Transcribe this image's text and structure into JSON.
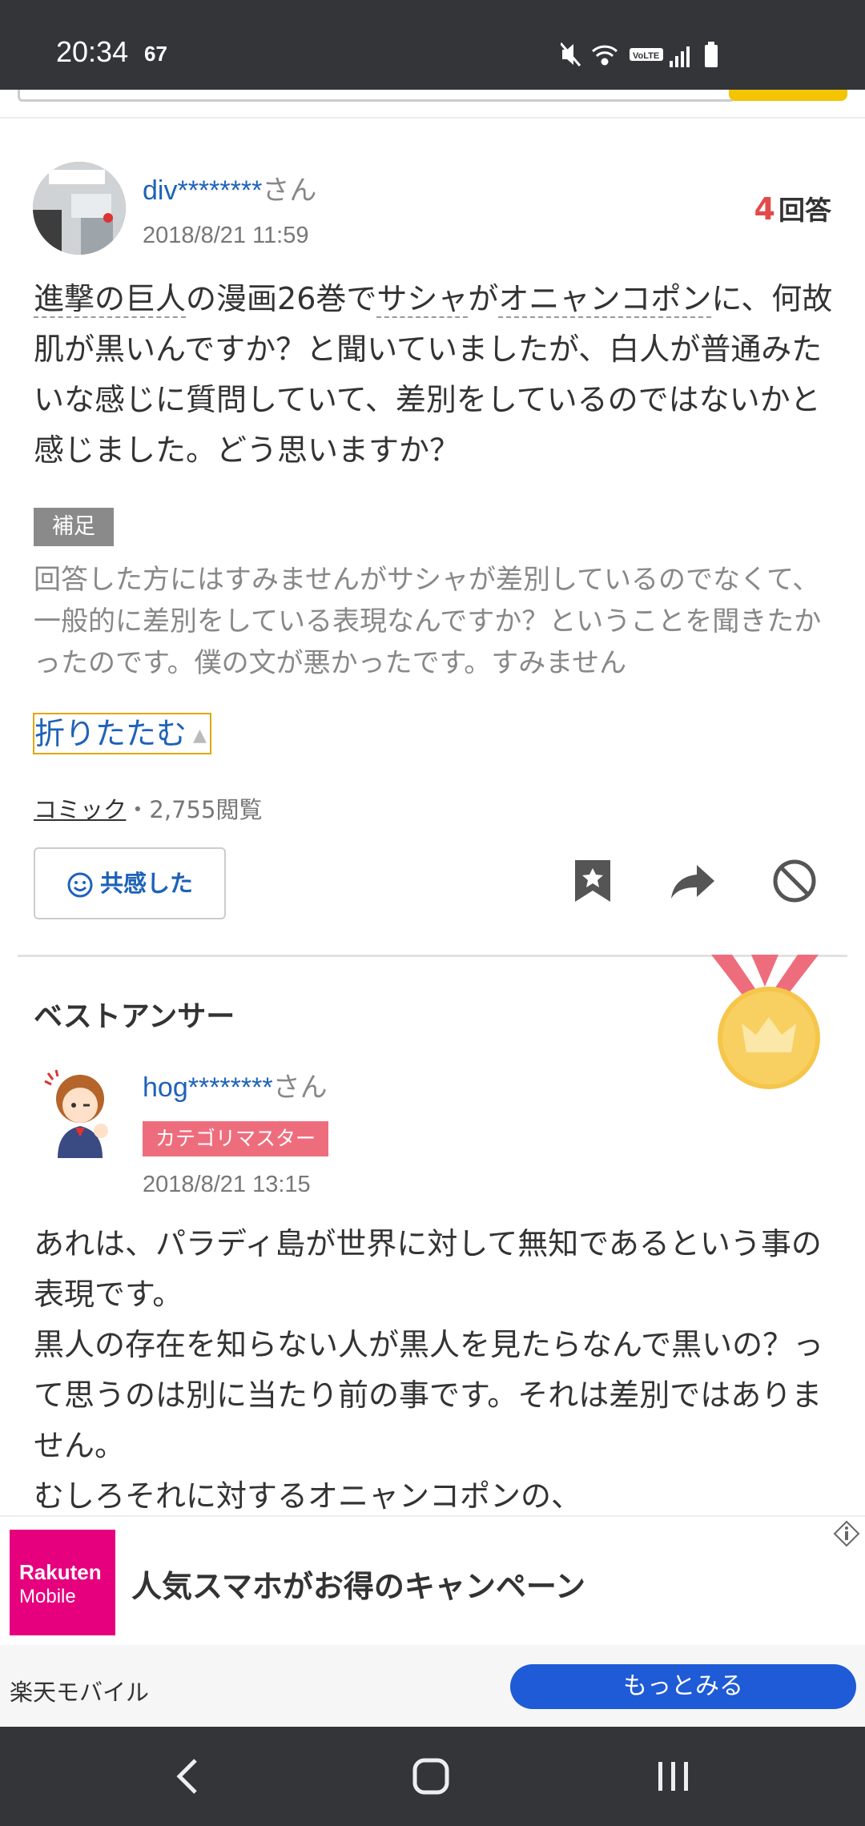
{
  "status_bar": {
    "time": "20:34",
    "speed": "67",
    "icons": [
      "mute-icon",
      "wifi-icon",
      "volte-icon",
      "signal-icon",
      "battery-icon"
    ]
  },
  "question": {
    "username": "div********",
    "honorific": "さん",
    "date": "2018/8/21 11:59",
    "answer_count": "4",
    "answer_label": "回答",
    "body": {
      "kw1": "進撃の巨人",
      "t1": "の漫画26巻で",
      "kw2": "サシャ",
      "t2": "が",
      "kw3": "オニャンコポン",
      "t3": "に、何故肌が黒いんですか？と聞いていましたが、白人が普通みたいな感じに質問していて、差別をしているのではないかと感じました。どう思いますか？"
    },
    "supplement_label": "補足",
    "supplement_text": "回答した方にはすみませんがサシャが差別しているのでなくて、一般的に差別をしている表現なんですか？ということを聞きたかったのです。僕の文が悪かったです。すみません",
    "fold_label": "折りたたむ",
    "category": "コミック",
    "views": "・2,755閲覧",
    "empathy_label": "共感した"
  },
  "best_answer": {
    "title": "ベストアンサー",
    "username": "hog********",
    "honorific": "さん",
    "badge": "カテゴリマスター",
    "date": "2018/8/21 13:15",
    "body": "あれは、パラディ島が世界に対して無知であるという事の表現です。\n黒人の存在を知らない人が黒人を見たらなんで黒いの？って思うのは別に当たり前の事です。それは差別ではありません。\nむしろそれに対するオニャンコポンの、"
  },
  "ad": {
    "logo_line1": "Rakuten",
    "logo_line2": "Mobile",
    "headline": "人気スマホがお得のキャンペーン",
    "advertiser": "楽天モバイル",
    "cta": "もっとみる"
  },
  "colors": {
    "link": "#1e62b8",
    "answer_count": "#e34a4a",
    "master_badge": "#ee6d7d",
    "ad_button": "#1f5bd6",
    "rakuten": "#e6007e"
  }
}
